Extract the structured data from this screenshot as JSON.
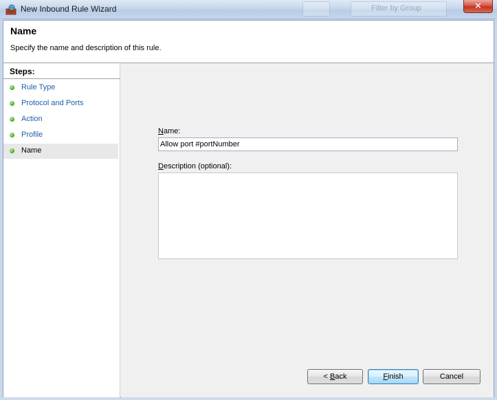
{
  "window": {
    "title": "New Inbound Rule Wizard",
    "close_label": "✕",
    "background_hint": "Filter by Group"
  },
  "header": {
    "title": "Name",
    "subtitle": "Specify the name and description of this rule."
  },
  "steps": {
    "title": "Steps:",
    "items": [
      {
        "label": "Rule Type",
        "current": false
      },
      {
        "label": "Protocol and Ports",
        "current": false
      },
      {
        "label": "Action",
        "current": false
      },
      {
        "label": "Profile",
        "current": false
      },
      {
        "label": "Name",
        "current": true
      }
    ]
  },
  "form": {
    "name_label_accel": "N",
    "name_label_rest": "ame:",
    "name_value": "Allow port #portNumber",
    "desc_label_accel": "D",
    "desc_label_rest": "escription (optional):",
    "desc_value": ""
  },
  "buttons": {
    "back_prefix": "< ",
    "back_accel": "B",
    "back_rest": "ack",
    "finish_accel": "F",
    "finish_rest": "inish",
    "cancel": "Cancel"
  },
  "colors": {
    "step_link": "#1e5ea8",
    "step_dot": "#4cae2a"
  }
}
